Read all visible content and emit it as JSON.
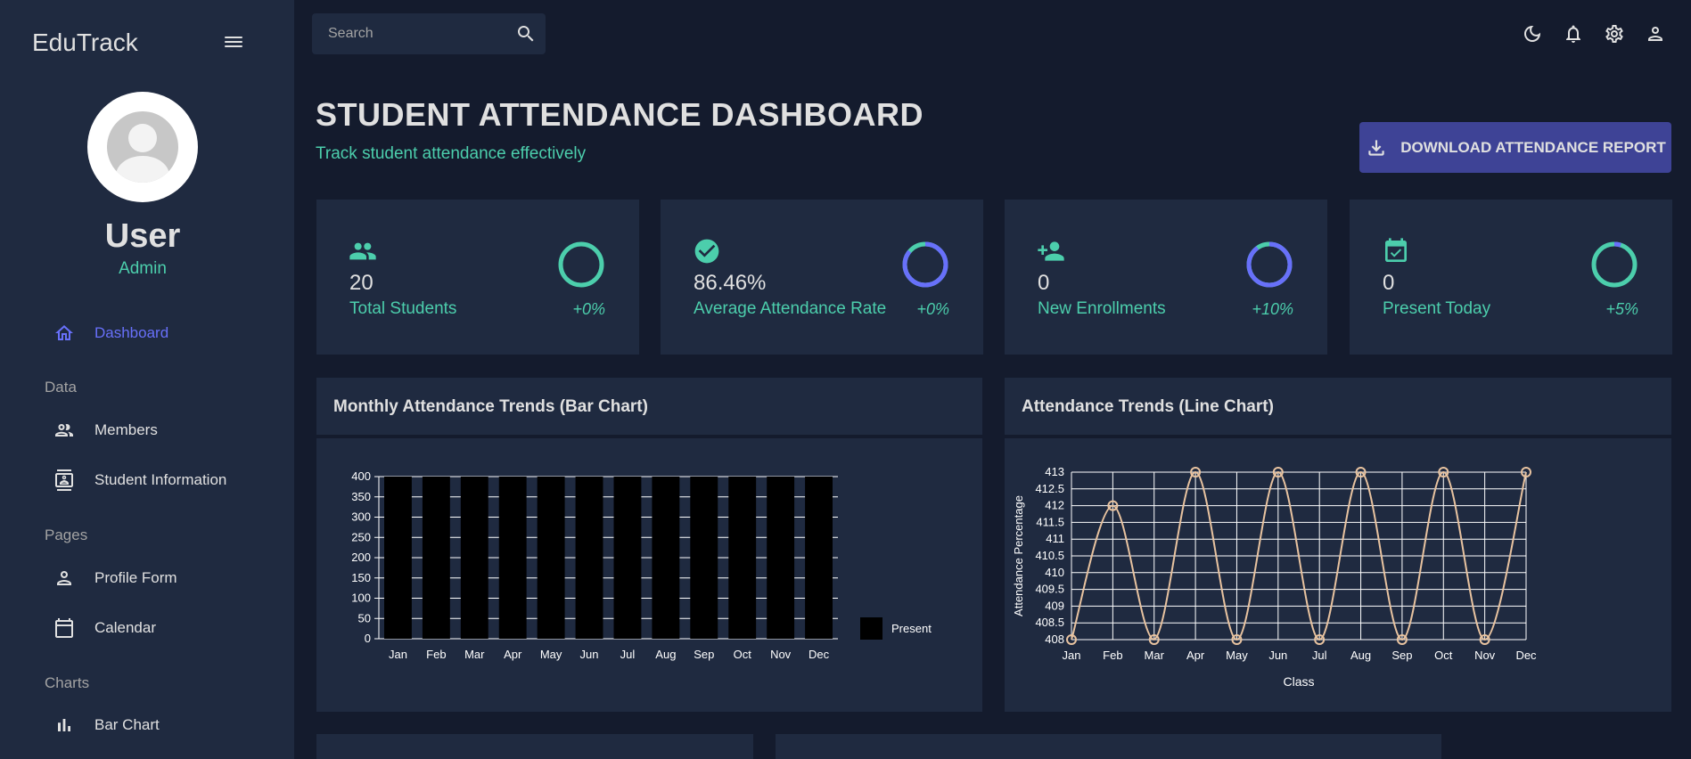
{
  "app": {
    "brand": "EduTrack"
  },
  "sidebar": {
    "user_name": "User",
    "user_role": "Admin",
    "items": [
      {
        "label": "Dashboard",
        "icon": "home-icon",
        "active": true
      },
      {
        "section": "Data"
      },
      {
        "label": "Members",
        "icon": "people-icon"
      },
      {
        "label": "Student Information",
        "icon": "contact-card-icon"
      },
      {
        "section": "Pages"
      },
      {
        "label": "Profile Form",
        "icon": "person-icon"
      },
      {
        "label": "Calendar",
        "icon": "calendar-icon"
      },
      {
        "section": "Charts"
      },
      {
        "label": "Bar Chart",
        "icon": "bar-chart-icon"
      }
    ],
    "sections": {
      "data": "Data",
      "pages": "Pages",
      "charts": "Charts"
    },
    "labels": {
      "dashboard": "Dashboard",
      "members": "Members",
      "student_information": "Student Information",
      "profile_form": "Profile Form",
      "calendar": "Calendar",
      "bar_chart": "Bar Chart"
    }
  },
  "topbar": {
    "search_placeholder": "Search",
    "icons": [
      "dark-mode-icon",
      "bell-icon",
      "settings-icon",
      "person-icon"
    ]
  },
  "header": {
    "title": "STUDENT ATTENDANCE DASHBOARD",
    "subtitle": "Track student attendance effectively",
    "download_label": "DOWNLOAD ATTENDANCE REPORT"
  },
  "stats": [
    {
      "value": "20",
      "title": "Total Students",
      "delta": "+0%",
      "progress": 0.0,
      "icon": "people-icon"
    },
    {
      "value": "86.46%",
      "title": "Average Attendance Rate",
      "delta": "+0%",
      "progress": 0.86,
      "icon": "check-circle-icon"
    },
    {
      "value": "0",
      "title": "New Enrollments",
      "delta": "+10%",
      "progress": 0.9,
      "icon": "person-add-icon"
    },
    {
      "value": "0",
      "title": "Present Today",
      "delta": "+5%",
      "progress": 0.05,
      "icon": "event-available-icon"
    }
  ],
  "colors": {
    "background": "#141b2d",
    "panel": "#1f2a40",
    "accent_green": "#4cceac",
    "accent_blue": "#6870fa",
    "button": "#3e4396",
    "line_series": "#e8c3a0"
  },
  "panels": {
    "bar_title": "Monthly Attendance Trends (Bar Chart)",
    "line_title": "Attendance Trends (Line Chart)"
  },
  "chart_data": [
    {
      "type": "bar",
      "title": "Monthly Attendance Trends (Bar Chart)",
      "categories": [
        "Jan",
        "Feb",
        "Mar",
        "Apr",
        "May",
        "Jun",
        "Jul",
        "Aug",
        "Sep",
        "Oct",
        "Nov",
        "Dec"
      ],
      "series": [
        {
          "name": "Present",
          "values": [
            408,
            412,
            408,
            413,
            408,
            413,
            408,
            413,
            408,
            413,
            408,
            413
          ],
          "color": "#000000"
        }
      ],
      "ylim": [
        0,
        400
      ],
      "yticks": [
        0,
        50,
        100,
        150,
        200,
        250,
        300,
        350,
        400
      ],
      "legend": "right",
      "grid": true
    },
    {
      "type": "line",
      "title": "Attendance Trends (Line Chart)",
      "x": [
        "Jan",
        "Feb",
        "Mar",
        "Apr",
        "May",
        "Jun",
        "Jul",
        "Aug",
        "Sep",
        "Oct",
        "Nov",
        "Dec"
      ],
      "series": [
        {
          "values": [
            408,
            412,
            408,
            413,
            408,
            413,
            408,
            413,
            408,
            413,
            408,
            413
          ],
          "color": "#e8c3a0"
        }
      ],
      "xlabel": "Class",
      "ylabel": "Attendance Percentage",
      "ylim": [
        408,
        413
      ],
      "yticks": [
        408,
        408.5,
        409,
        409.5,
        410,
        410.5,
        411,
        411.5,
        412,
        412.5,
        413
      ],
      "grid": true
    }
  ]
}
